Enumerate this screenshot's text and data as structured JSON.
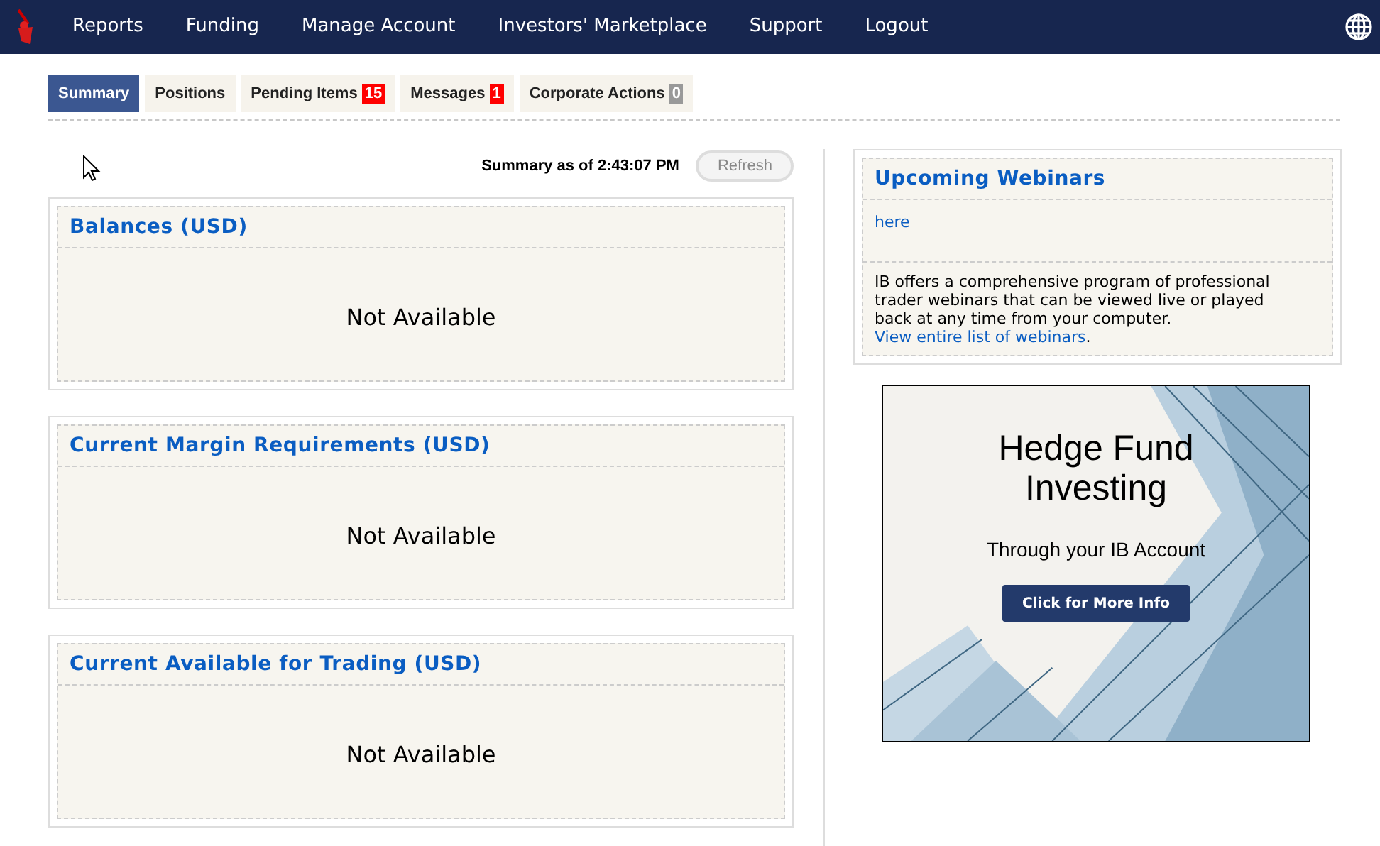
{
  "nav": {
    "items": [
      "Reports",
      "Funding",
      "Manage Account",
      "Investors' Marketplace",
      "Support",
      "Logout"
    ]
  },
  "tabs": [
    {
      "label": "Summary",
      "selected": true
    },
    {
      "label": "Positions",
      "selected": false
    },
    {
      "label": "Pending Items",
      "selected": false,
      "badge": "15",
      "color": "#ff0000"
    },
    {
      "label": "Messages",
      "selected": false,
      "badge": "1",
      "color": "#ff0000"
    },
    {
      "label": "Corporate Actions",
      "selected": false,
      "badge": "0",
      "color": "#999999"
    }
  ],
  "summary": {
    "timestamp": "Summary as of 2:43:07 PM",
    "refresh": {
      "label": "Refresh",
      "disabled": true
    }
  },
  "panels": [
    {
      "title": "Balances (USD)",
      "body": "Not Available"
    },
    {
      "title": "Current Margin Requirements (USD)",
      "body": "Not Available"
    },
    {
      "title": "Current Available for Trading (USD)",
      "body": "Not Available"
    }
  ],
  "webinars": {
    "title": "Upcoming Webinars",
    "link": "here",
    "description": "IB offers a comprehensive program of professional trader webinars that can be viewed live or played back at any time from your computer.",
    "list_link": "View entire list of webinars",
    "list_link_suffix": "."
  },
  "ad": {
    "headline": "Hedge Fund Investing",
    "subline": "Through your IB Account",
    "button": "Click for More Info"
  }
}
